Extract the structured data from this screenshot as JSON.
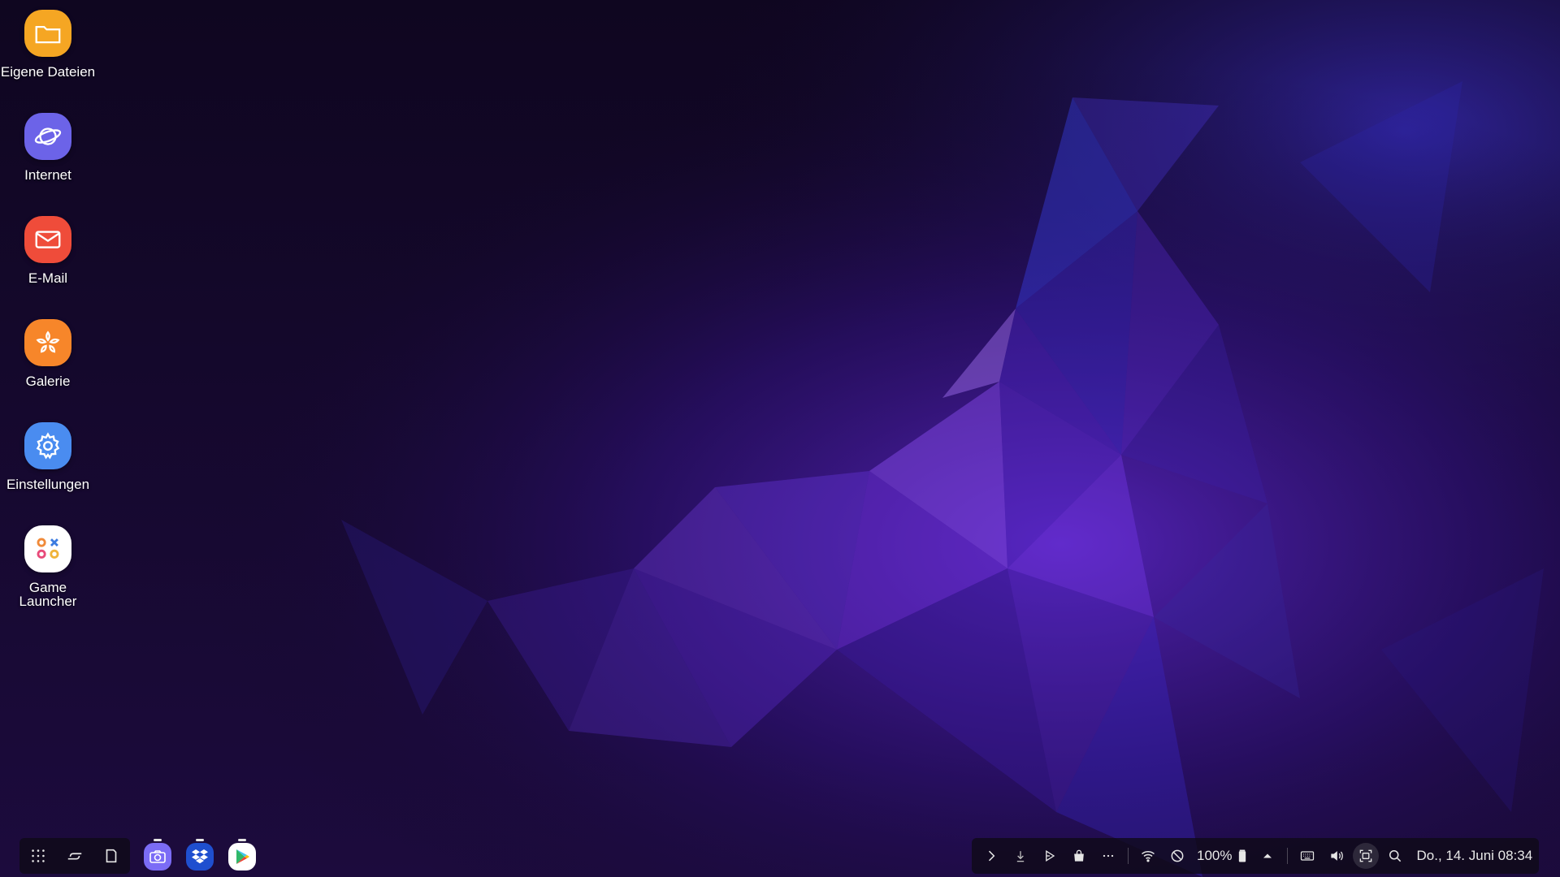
{
  "desktop": {
    "icons": [
      {
        "label": "Eigene Dateien",
        "icon": "folder-icon",
        "color": "#f5a623"
      },
      {
        "label": "Internet",
        "icon": "planet-icon",
        "color": "#6c63e8"
      },
      {
        "label": "E-Mail",
        "icon": "envelope-icon",
        "color": "#ef4c3a"
      },
      {
        "label": "Galerie",
        "icon": "flower-icon",
        "color": "#f7862a"
      },
      {
        "label": "Einstellungen",
        "icon": "gear-icon",
        "color": "#4a8cf0"
      },
      {
        "label": "Game\nLauncher",
        "icon": "game-launcher-icon",
        "color": "#ffffff"
      }
    ]
  },
  "taskbar": {
    "nav": [
      "apps-grid-icon",
      "recent-apps-icon",
      "home-icon"
    ],
    "pinned": [
      {
        "name": "camera-icon",
        "color": "#7b6cf6"
      },
      {
        "name": "dropbox-icon",
        "color": "#1f4fcf"
      },
      {
        "name": "play-store-icon",
        "color": "#ffffff"
      }
    ],
    "tray": {
      "icons_left": [
        "chevron-right-icon",
        "download-icon",
        "play-protect-icon",
        "bag-icon",
        "more-icon"
      ],
      "battery_text": "100%",
      "datetime": "Do., 14. Juni 08:34"
    }
  },
  "colors": {
    "wallpaper_base": "#14082b",
    "wallpaper_accent": "#7b3df0",
    "wallpaper_blue": "#3a3ae0"
  }
}
